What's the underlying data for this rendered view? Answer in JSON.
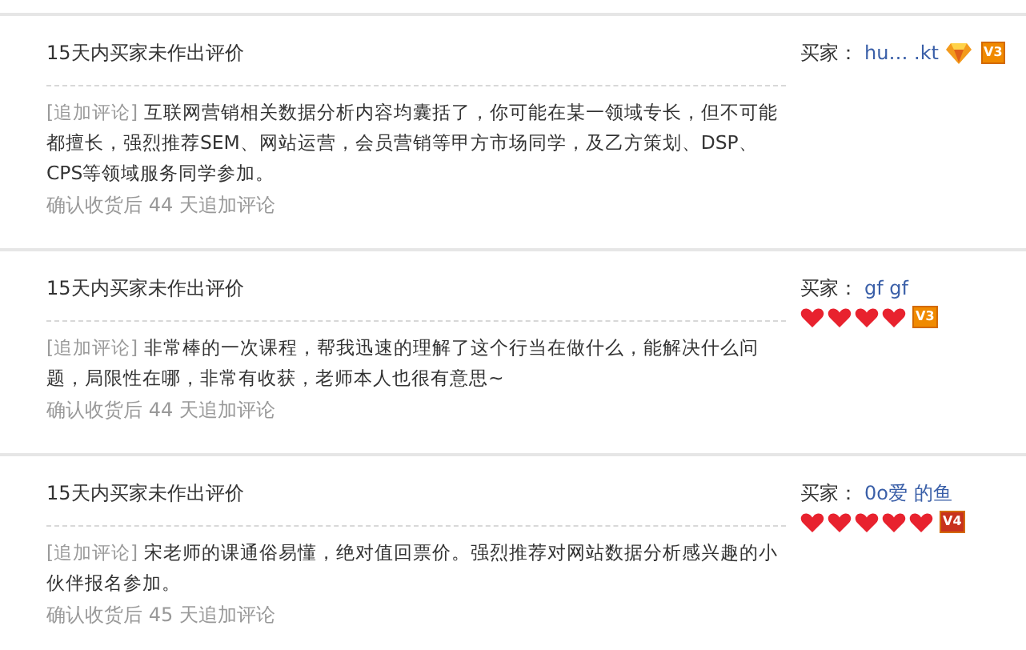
{
  "reviews": [
    {
      "title": "15天内买家未作出评价",
      "tag": "[追加评论]",
      "text": "互联网营销相关数据分析内容均囊括了，你可能在某一领域专长，但不可能都擅长，强烈推荐SEM、网站运营，会员营销等甲方市场同学，及乙方策划、DSP、CPS等领域服务同学参加。",
      "date": "确认收货后 44 天追加评论",
      "buyer_label": "买家：",
      "buyer": "hu…  .kt",
      "rank": [
        {
          "kind": "diamond"
        }
      ],
      "vip": {
        "text": "V3",
        "color": "#f08a00"
      }
    },
    {
      "title": "15天内买家未作出评价",
      "tag": "[追加评论]",
      "text": "非常棒的一次课程，帮我迅速的理解了这个行当在做什么，能解决什么问题，局限性在哪，非常有收获，老师本人也很有意思~",
      "date": "确认收货后 44 天追加评论",
      "buyer_label": "买家：",
      "buyer": "gf   gf",
      "rank": [
        {
          "kind": "heart"
        },
        {
          "kind": "heart"
        },
        {
          "kind": "heart"
        },
        {
          "kind": "heart"
        }
      ],
      "vip": {
        "text": "V3",
        "color": "#f08a00"
      }
    },
    {
      "title": "15天内买家未作出评价",
      "tag": "[追加评论]",
      "text": "宋老师的课通俗易懂，绝对值回票价。强烈推荐对网站数据分析感兴趣的小伙伴报名参加。",
      "date": "确认收货后 45 天追加评论",
      "buyer_label": "买家：",
      "buyer": "0o爱  的鱼",
      "rank": [
        {
          "kind": "heart"
        },
        {
          "kind": "heart"
        },
        {
          "kind": "heart"
        },
        {
          "kind": "heart"
        },
        {
          "kind": "heart"
        }
      ],
      "vip": {
        "text": "V4",
        "color": "#c8321e"
      }
    }
  ]
}
